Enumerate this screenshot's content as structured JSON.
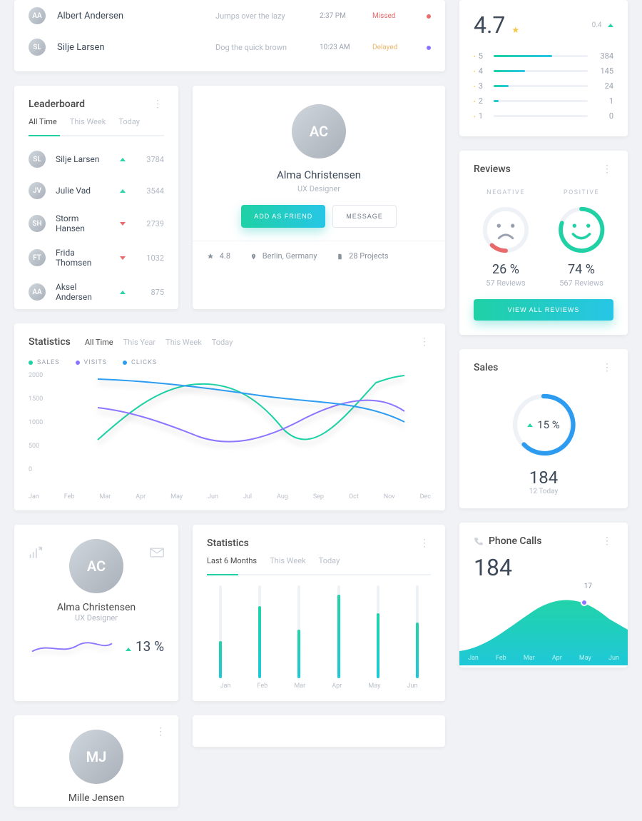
{
  "activity": [
    {
      "name": "Albert Andersen",
      "note": "Jumps over the lazy",
      "time": "2:37 PM",
      "status": "Missed",
      "status_color": "#e86a6a",
      "dot": "#e86a6a"
    },
    {
      "name": "Silje Larsen",
      "note": "Dog the quick brown",
      "time": "10:23 AM",
      "status": "Delayed",
      "status_color": "#e8b76a",
      "dot": "#8d74ff"
    }
  ],
  "leaderboard": {
    "title": "Leaderboard",
    "tabs": [
      "All Time",
      "This Week",
      "Today"
    ],
    "rows": [
      {
        "name": "Silje Larsen",
        "dir": "up",
        "score": 3784
      },
      {
        "name": "Julie Vad",
        "dir": "up",
        "score": 3544
      },
      {
        "name": "Storm Hansen",
        "dir": "down",
        "score": 2739
      },
      {
        "name": "Frida Thomsen",
        "dir": "down",
        "score": 1032
      },
      {
        "name": "Aksel Andersen",
        "dir": "up",
        "score": 875
      }
    ]
  },
  "profile": {
    "name": "Alma Christensen",
    "role": "UX Designer",
    "add_btn": "ADD AS FRIEND",
    "msg_btn": "MESSAGE",
    "rating": "4.8",
    "location": "Berlin, Germany",
    "projects": "28 Projects"
  },
  "rating": {
    "score": "4.7",
    "delta": "0.4",
    "rows": [
      {
        "star": "5",
        "count": 384,
        "pct": 62
      },
      {
        "star": "4",
        "count": 145,
        "pct": 33
      },
      {
        "star": "3",
        "count": 24,
        "pct": 16
      },
      {
        "star": "2",
        "count": 1,
        "pct": 5
      },
      {
        "star": "1",
        "count": 0,
        "pct": 0
      }
    ]
  },
  "reviews": {
    "title": "Reviews",
    "neg_label": "NEGATIVE",
    "neg_pct": "26 %",
    "neg_sub": "57 Reviews",
    "pos_label": "POSITIVE",
    "pos_pct": "74 %",
    "pos_sub": "567 Reviews",
    "cta": "VIEW ALL REVIEWS"
  },
  "sales": {
    "title": "Sales",
    "pct": "15 %",
    "big": "184",
    "sub": "12 Today"
  },
  "phone": {
    "title": "Phone Calls",
    "big": "184",
    "point_label": "17",
    "months": [
      "Jan",
      "Feb",
      "Mar",
      "Apr",
      "May",
      "Jun"
    ]
  },
  "stats": {
    "title": "Statistics",
    "tabs": [
      "All Time",
      "This Year",
      "This Week",
      "Today"
    ],
    "legend": {
      "sales": "SALES",
      "visits": "VISITS",
      "clicks": "CLICKS"
    },
    "ylabels": [
      "2000",
      "1500",
      "1000",
      "500",
      "0"
    ],
    "months": [
      "Jan",
      "Feb",
      "Mar",
      "Apr",
      "May",
      "Jun",
      "Jul",
      "Aug",
      "Sep",
      "Oct",
      "Nov",
      "Dec"
    ]
  },
  "mini_profile": {
    "name": "Alma Christensen",
    "role": "UX Designer",
    "pct": "13 %"
  },
  "stats2": {
    "title": "Statistics",
    "tabs": [
      "Last 6 Months",
      "This Week",
      "Today"
    ],
    "months": [
      "Jan",
      "Feb",
      "Mar",
      "Apr",
      "May",
      "Jun"
    ],
    "values": [
      40,
      78,
      52,
      90,
      70,
      60
    ]
  },
  "person_card": {
    "name": "Mille Jensen"
  },
  "chart_data": [
    {
      "type": "line",
      "id": "statistics-main",
      "title": "Statistics",
      "xlabel": "",
      "ylabel": "",
      "x": [
        "Jan",
        "Feb",
        "Mar",
        "Apr",
        "May",
        "Jun",
        "Jul",
        "Aug",
        "Sep",
        "Oct",
        "Nov",
        "Dec"
      ],
      "ylim": [
        0,
        2000
      ],
      "series": [
        {
          "name": "SALES",
          "color": "#1fd1a5",
          "values": [
            700,
            1100,
            1500,
            1700,
            1750,
            1600,
            1200,
            900,
            1200,
            1600,
            1850,
            1900
          ]
        },
        {
          "name": "VISITS",
          "color": "#8d74ff",
          "values": [
            1250,
            1200,
            1050,
            850,
            650,
            600,
            700,
            900,
            1100,
            1300,
            1450,
            1200
          ]
        },
        {
          "name": "CLICKS",
          "color": "#2d9cf0",
          "values": [
            1800,
            1850,
            1800,
            1750,
            1700,
            1650,
            1600,
            1550,
            1500,
            1500,
            1550,
            1050
          ]
        }
      ]
    },
    {
      "type": "bar",
      "id": "statistics-mini",
      "categories": [
        "Jan",
        "Feb",
        "Mar",
        "Apr",
        "May",
        "Jun"
      ],
      "values": [
        40,
        78,
        52,
        90,
        70,
        60
      ],
      "ylim": [
        0,
        100
      ]
    },
    {
      "type": "bar",
      "id": "rating-breakdown",
      "categories": [
        "5",
        "4",
        "3",
        "2",
        "1"
      ],
      "values": [
        384,
        145,
        24,
        1,
        0
      ]
    },
    {
      "type": "area",
      "id": "phone-calls",
      "x": [
        "Jan",
        "Feb",
        "Mar",
        "Apr",
        "May",
        "Jun"
      ],
      "values": [
        30,
        40,
        60,
        90,
        80,
        60
      ],
      "annotations": [
        {
          "x": "May",
          "label": "17"
        }
      ]
    }
  ]
}
